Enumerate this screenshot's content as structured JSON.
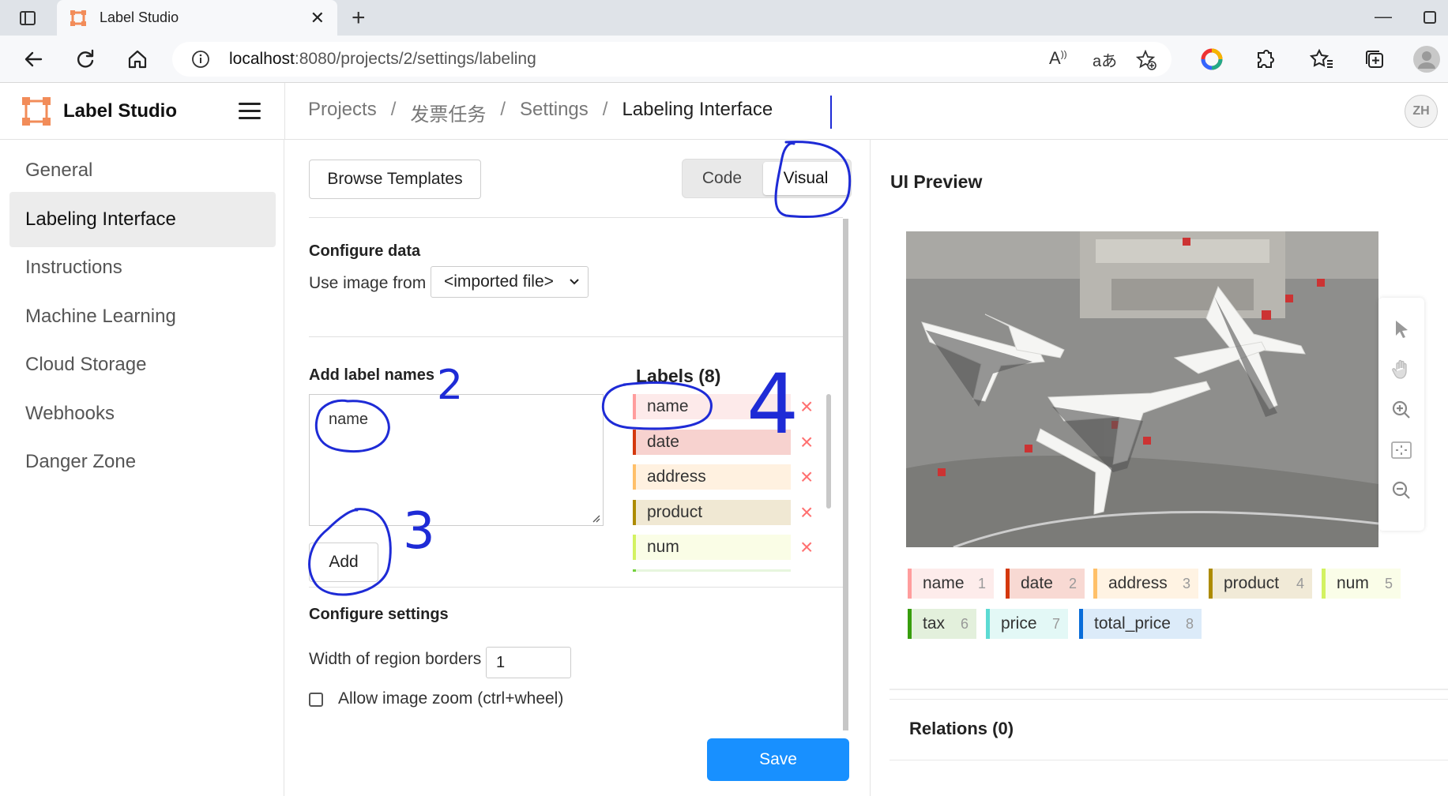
{
  "browser": {
    "tab_title": "Label Studio",
    "url_host": "localhost",
    "url_path": ":8080/projects/2/settings/labeling"
  },
  "header": {
    "brand": "Label Studio",
    "breadcrumb": [
      "Projects",
      "发票任务",
      "Settings",
      "Labeling Interface"
    ],
    "avatar": "ZH"
  },
  "sidebar": {
    "items": [
      {
        "label": "General"
      },
      {
        "label": "Labeling Interface",
        "active": true
      },
      {
        "label": "Instructions"
      },
      {
        "label": "Machine Learning"
      },
      {
        "label": "Cloud Storage"
      },
      {
        "label": "Webhooks"
      },
      {
        "label": "Danger Zone"
      }
    ]
  },
  "editor": {
    "browse_templates": "Browse Templates",
    "mode_code": "Code",
    "mode_visual": "Visual",
    "configure_data_title": "Configure data",
    "use_image_from": "Use image from",
    "image_source": "<imported file>",
    "add_label_names": "Add label names",
    "textarea_value": "name",
    "add_button": "Add",
    "labels_title": "Labels (8)",
    "labels": [
      {
        "name": "name",
        "color": "#ff9d9d",
        "bg": "#fdeaea"
      },
      {
        "name": "date",
        "color": "#d4380d",
        "bg": "#f7d2cf"
      },
      {
        "name": "address",
        "color": "#ffc069",
        "bg": "#fff1e0"
      },
      {
        "name": "product",
        "color": "#ad8b00",
        "bg": "#f0e8d3"
      },
      {
        "name": "num",
        "color": "#d3f261",
        "bg": "#fafde6"
      }
    ],
    "configure_settings_title": "Configure settings",
    "region_border_label": "Width of region borders",
    "region_border_value": "1",
    "zoom_label": "Allow image zoom (ctrl+wheel)",
    "save_button": "Save"
  },
  "preview": {
    "title": "UI Preview",
    "chips": [
      {
        "name": "name",
        "num": "1",
        "color": "#ff9d9d",
        "bg": "#fdeceb"
      },
      {
        "name": "date",
        "num": "2",
        "color": "#d4380d",
        "bg": "#f8d9d3"
      },
      {
        "name": "address",
        "num": "3",
        "color": "#ffc069",
        "bg": "#fff3e3"
      },
      {
        "name": "product",
        "num": "4",
        "color": "#ad8b00",
        "bg": "#f1ead7"
      },
      {
        "name": "num",
        "num": "5",
        "color": "#d3f261",
        "bg": "#fafde8"
      },
      {
        "name": "tax",
        "num": "6",
        "color": "#389e0d",
        "bg": "#e3f0dc"
      },
      {
        "name": "price",
        "num": "7",
        "color": "#5cdbd3",
        "bg": "#e3f8f6"
      },
      {
        "name": "total_price",
        "num": "8",
        "color": "#096dd9",
        "bg": "#dcebf9"
      }
    ],
    "relations": "Relations (0)"
  },
  "annotations": [
    "2",
    "3",
    "4"
  ]
}
